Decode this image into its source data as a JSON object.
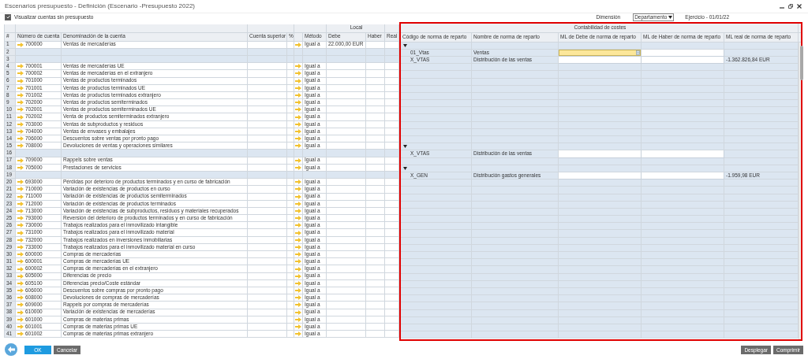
{
  "window": {
    "title": "Escenarios presupuesto - Definición (Escenario -Presupuesto 2022)"
  },
  "options": {
    "show_unbudgeted": {
      "label": "Visualizar cuentas sin presupuesto",
      "checked": true
    },
    "dimension": {
      "label": "Dimensión",
      "value": "Departamento"
    },
    "fiscal_year": "Ejercicio - 01/01/22"
  },
  "table": {
    "group_header": "Local",
    "columns": [
      "#",
      "Número de cuenta",
      "Denominación de la cuenta",
      "Cuenta superior",
      "%",
      "Método",
      "Debe",
      "Haber",
      "Real"
    ]
  },
  "cost_panel": {
    "title": "Contabilidad de costes",
    "columns": [
      "Código de norma de reparto",
      "Nombre de norma de reparto",
      "ML de Debe de norma de reparto",
      "ML de Haber de norma de reparto",
      "ML real de norma de reparto"
    ]
  },
  "rows": [
    {
      "number": "1",
      "kind": "account",
      "account": "700000",
      "name": "Ventas de mercaderías",
      "method": "Igual a",
      "debe": "22.000,00 EUR",
      "distribution": {
        "kind": "group"
      }
    },
    {
      "number": "2",
      "kind": "blank",
      "distribution": {
        "kind": "rule",
        "code": "01_Vtas",
        "name": "Ventas",
        "focused": true
      }
    },
    {
      "number": "3",
      "kind": "blank",
      "distribution": {
        "kind": "rule",
        "code": "X_VTAS",
        "name": "Distribución de las ventas",
        "focused": false,
        "real": "-1.362.826,84 EUR"
      }
    },
    {
      "number": "4",
      "kind": "account",
      "account": "700001",
      "name": "Ventas de mercaderías UE",
      "method": "Igual a",
      "distribution": {
        "kind": "empty"
      }
    },
    {
      "number": "5",
      "kind": "account",
      "account": "700002",
      "name": "Ventas de mercaderías en el extranjero",
      "method": "Igual a",
      "distribution": {
        "kind": "empty"
      }
    },
    {
      "number": "6",
      "kind": "account",
      "account": "701000",
      "name": "Ventas de productos terminados",
      "method": "Igual a",
      "distribution": {
        "kind": "empty"
      }
    },
    {
      "number": "7",
      "kind": "account",
      "account": "701001",
      "name": "Ventas de productos terminados UE",
      "method": "Igual a",
      "distribution": {
        "kind": "empty"
      }
    },
    {
      "number": "8",
      "kind": "account",
      "account": "701002",
      "name": "Ventas de productos terminados extranjero",
      "method": "Igual a",
      "distribution": {
        "kind": "empty"
      }
    },
    {
      "number": "9",
      "kind": "account",
      "account": "702000",
      "name": "Ventas de productos semiterminados",
      "method": "Igual a",
      "distribution": {
        "kind": "empty"
      }
    },
    {
      "number": "10",
      "kind": "account",
      "account": "702001",
      "name": "Ventas de productos semiterminados UE",
      "method": "Igual a",
      "distribution": {
        "kind": "empty"
      }
    },
    {
      "number": "11",
      "kind": "account",
      "account": "702002",
      "name": "Venta de productos semiterminados extranjero",
      "method": "Igual a",
      "distribution": {
        "kind": "empty"
      }
    },
    {
      "number": "12",
      "kind": "account",
      "account": "703000",
      "name": "Ventas de subproductos y residuos",
      "method": "Igual a",
      "distribution": {
        "kind": "empty"
      }
    },
    {
      "number": "13",
      "kind": "account",
      "account": "704000",
      "name": "Ventas de envases y embalajes",
      "method": "Igual a",
      "distribution": {
        "kind": "empty"
      }
    },
    {
      "number": "14",
      "kind": "account",
      "account": "706000",
      "name": "Descuentos sobre ventas por pronto pago",
      "method": "Igual a",
      "distribution": {
        "kind": "empty"
      }
    },
    {
      "number": "15",
      "kind": "account",
      "account": "708000",
      "name": "Devoluciones de ventas y operaciones similares",
      "method": "Igual a",
      "distribution": {
        "kind": "group"
      }
    },
    {
      "number": "16",
      "kind": "blank",
      "distribution": {
        "kind": "rule",
        "code": "X_VTAS",
        "name": "Distribución de las ventas",
        "focused": false
      }
    },
    {
      "number": "17",
      "kind": "account",
      "account": "709000",
      "name": "Rappels sobre ventas",
      "method": "Igual a",
      "distribution": {
        "kind": "empty"
      }
    },
    {
      "number": "18",
      "kind": "account",
      "account": "705000",
      "name": "Prestaciones de servicios",
      "method": "Igual a",
      "distribution": {
        "kind": "group"
      }
    },
    {
      "number": "19",
      "kind": "blank",
      "distribution": {
        "kind": "rule",
        "code": "X_GEN",
        "name": "Distribución gastos generales",
        "focused": false,
        "real": "-1.959,98 EUR"
      }
    },
    {
      "number": "20",
      "kind": "account",
      "account": "693000",
      "name": "Pérdidas por deterioro de productos terminados y en curso de fabricación",
      "method": "Igual a",
      "distribution": {
        "kind": "empty"
      }
    },
    {
      "number": "21",
      "kind": "account",
      "account": "710000",
      "name": "Variación de existencias de productos en curso",
      "method": "Igual a",
      "distribution": {
        "kind": "empty"
      }
    },
    {
      "number": "22",
      "kind": "account",
      "account": "711000",
      "name": "Variación de existencias de productos semiterminados",
      "method": "Igual a",
      "distribution": {
        "kind": "empty"
      }
    },
    {
      "number": "23",
      "kind": "account",
      "account": "712000",
      "name": "Variación de existencias de productos terminados",
      "method": "Igual a",
      "distribution": {
        "kind": "empty"
      }
    },
    {
      "number": "24",
      "kind": "account",
      "account": "713000",
      "name": "Variación de existencias de subproductos, residuos y materiales recuperados",
      "method": "Igual a",
      "distribution": {
        "kind": "empty"
      }
    },
    {
      "number": "25",
      "kind": "account",
      "account": "793000",
      "name": "Reversión del deterioro de productos terminados y en curso de fabricación",
      "method": "Igual a",
      "distribution": {
        "kind": "empty"
      }
    },
    {
      "number": "26",
      "kind": "account",
      "account": "730000",
      "name": "Trabajos realizados para el inmovilizado intangible",
      "method": "Igual a",
      "distribution": {
        "kind": "empty"
      }
    },
    {
      "number": "27",
      "kind": "account",
      "account": "731000",
      "name": "Trabajos realizados para el inmovilizado material",
      "method": "Igual a",
      "distribution": {
        "kind": "empty"
      }
    },
    {
      "number": "28",
      "kind": "account",
      "account": "732000",
      "name": "Trabajos realizados en inversiones inmobiliarias",
      "method": "Igual a",
      "distribution": {
        "kind": "empty"
      }
    },
    {
      "number": "29",
      "kind": "account",
      "account": "733000",
      "name": "Trabajos realizados para el inmovilizado material en curso",
      "method": "Igual a",
      "distribution": {
        "kind": "empty"
      }
    },
    {
      "number": "30",
      "kind": "account",
      "account": "600000",
      "name": "Compras de mercaderías",
      "method": "Igual a",
      "distribution": {
        "kind": "empty"
      }
    },
    {
      "number": "31",
      "kind": "account",
      "account": "600001",
      "name": "Compras de mercaderías UE",
      "method": "Igual a",
      "distribution": {
        "kind": "empty"
      }
    },
    {
      "number": "32",
      "kind": "account",
      "account": "600002",
      "name": "Compras de mercaderías en el extranjero",
      "method": "Igual a",
      "distribution": {
        "kind": "empty"
      }
    },
    {
      "number": "33",
      "kind": "account",
      "account": "605000",
      "name": "Diferencias de precio",
      "method": "Igual a",
      "distribution": {
        "kind": "empty"
      }
    },
    {
      "number": "34",
      "kind": "account",
      "account": "605100",
      "name": "Diferencias precio/Coste estándar",
      "method": "Igual a",
      "distribution": {
        "kind": "empty"
      }
    },
    {
      "number": "35",
      "kind": "account",
      "account": "606000",
      "name": "Descuentos sobre compras por pronto pago",
      "method": "Igual a",
      "distribution": {
        "kind": "empty"
      }
    },
    {
      "number": "36",
      "kind": "account",
      "account": "608000",
      "name": "Devoluciones de compras de mercaderías",
      "method": "Igual a",
      "distribution": {
        "kind": "empty"
      }
    },
    {
      "number": "37",
      "kind": "account",
      "account": "609000",
      "name": "Rappels por compras de mercaderías",
      "method": "Igual a",
      "distribution": {
        "kind": "empty"
      }
    },
    {
      "number": "38",
      "kind": "account",
      "account": "610000",
      "name": "Variación de existencias de mercaderías",
      "method": "Igual a",
      "distribution": {
        "kind": "empty"
      }
    },
    {
      "number": "39",
      "kind": "account",
      "account": "601000",
      "name": "Compras de materias primas",
      "method": "Igual a",
      "distribution": {
        "kind": "empty"
      }
    },
    {
      "number": "40",
      "kind": "account",
      "account": "601001",
      "name": "Compras de materias primas UE",
      "method": "Igual a",
      "distribution": {
        "kind": "empty"
      }
    },
    {
      "number": "41",
      "kind": "account",
      "account": "601002",
      "name": "Compras de materias primas extranjero",
      "method": "Igual a",
      "distribution": {
        "kind": "empty"
      }
    }
  ],
  "footer": {
    "left_buttons": [
      "OK",
      "Cancelar"
    ],
    "right_buttons": [
      "Desplegar",
      "Comprimir"
    ]
  }
}
